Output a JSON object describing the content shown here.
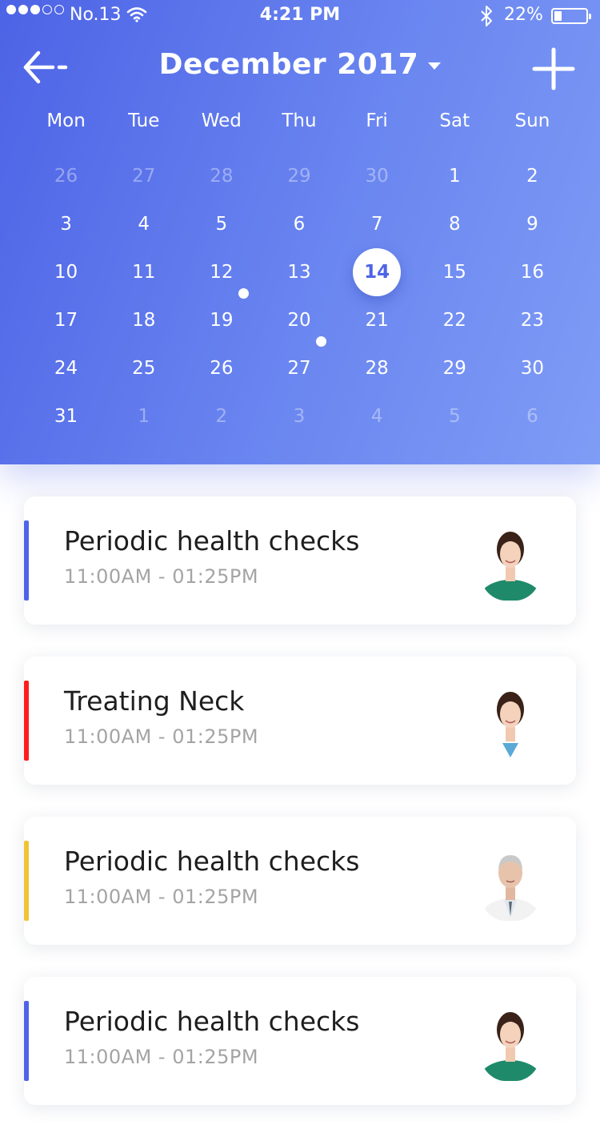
{
  "status_bar": {
    "carrier": "No.13",
    "time": "4:21 PM",
    "battery": "22%"
  },
  "header": {
    "month_title": "December 2017",
    "weekdays": [
      "Mon",
      "Tue",
      "Wed",
      "Thu",
      "Fri",
      "Sat",
      "Sun"
    ]
  },
  "calendar": {
    "weeks": [
      [
        "26",
        "27",
        "28",
        "29",
        "30",
        "1",
        "2"
      ],
      [
        "3",
        "4",
        "5",
        "6",
        "7",
        "8",
        "9"
      ],
      [
        "10",
        "11",
        "12",
        "13",
        "14",
        "15",
        "16"
      ],
      [
        "17",
        "18",
        "19",
        "20",
        "21",
        "22",
        "23"
      ],
      [
        "24",
        "25",
        "26",
        "27",
        "28",
        "29",
        "30"
      ],
      [
        "31",
        "1",
        "2",
        "3",
        "4",
        "5",
        "6"
      ]
    ],
    "selected_day": "14",
    "event_days": [
      "12",
      "20"
    ]
  },
  "appointments": [
    {
      "title": "Periodic health checks",
      "time": "11:00AM - 01:25PM",
      "color": "#4f63e8",
      "avatar": "female-doctor-avatar"
    },
    {
      "title": "Treating Neck",
      "time": "11:00AM - 01:25PM",
      "color": "#ff1c1c",
      "avatar": "female-doctor-avatar"
    },
    {
      "title": "Periodic health checks",
      "time": "11:00AM - 01:25PM",
      "color": "#f1c235",
      "avatar": "male-doctor-avatar"
    },
    {
      "title": "Periodic health checks",
      "time": "11:00AM - 01:25PM",
      "color": "#4f63e8",
      "avatar": "female-doctor-avatar"
    }
  ],
  "colors": {
    "accent": "#4e64e6",
    "header_gradient_start": "#4d63e6",
    "header_gradient_end": "#7f9cf6"
  }
}
